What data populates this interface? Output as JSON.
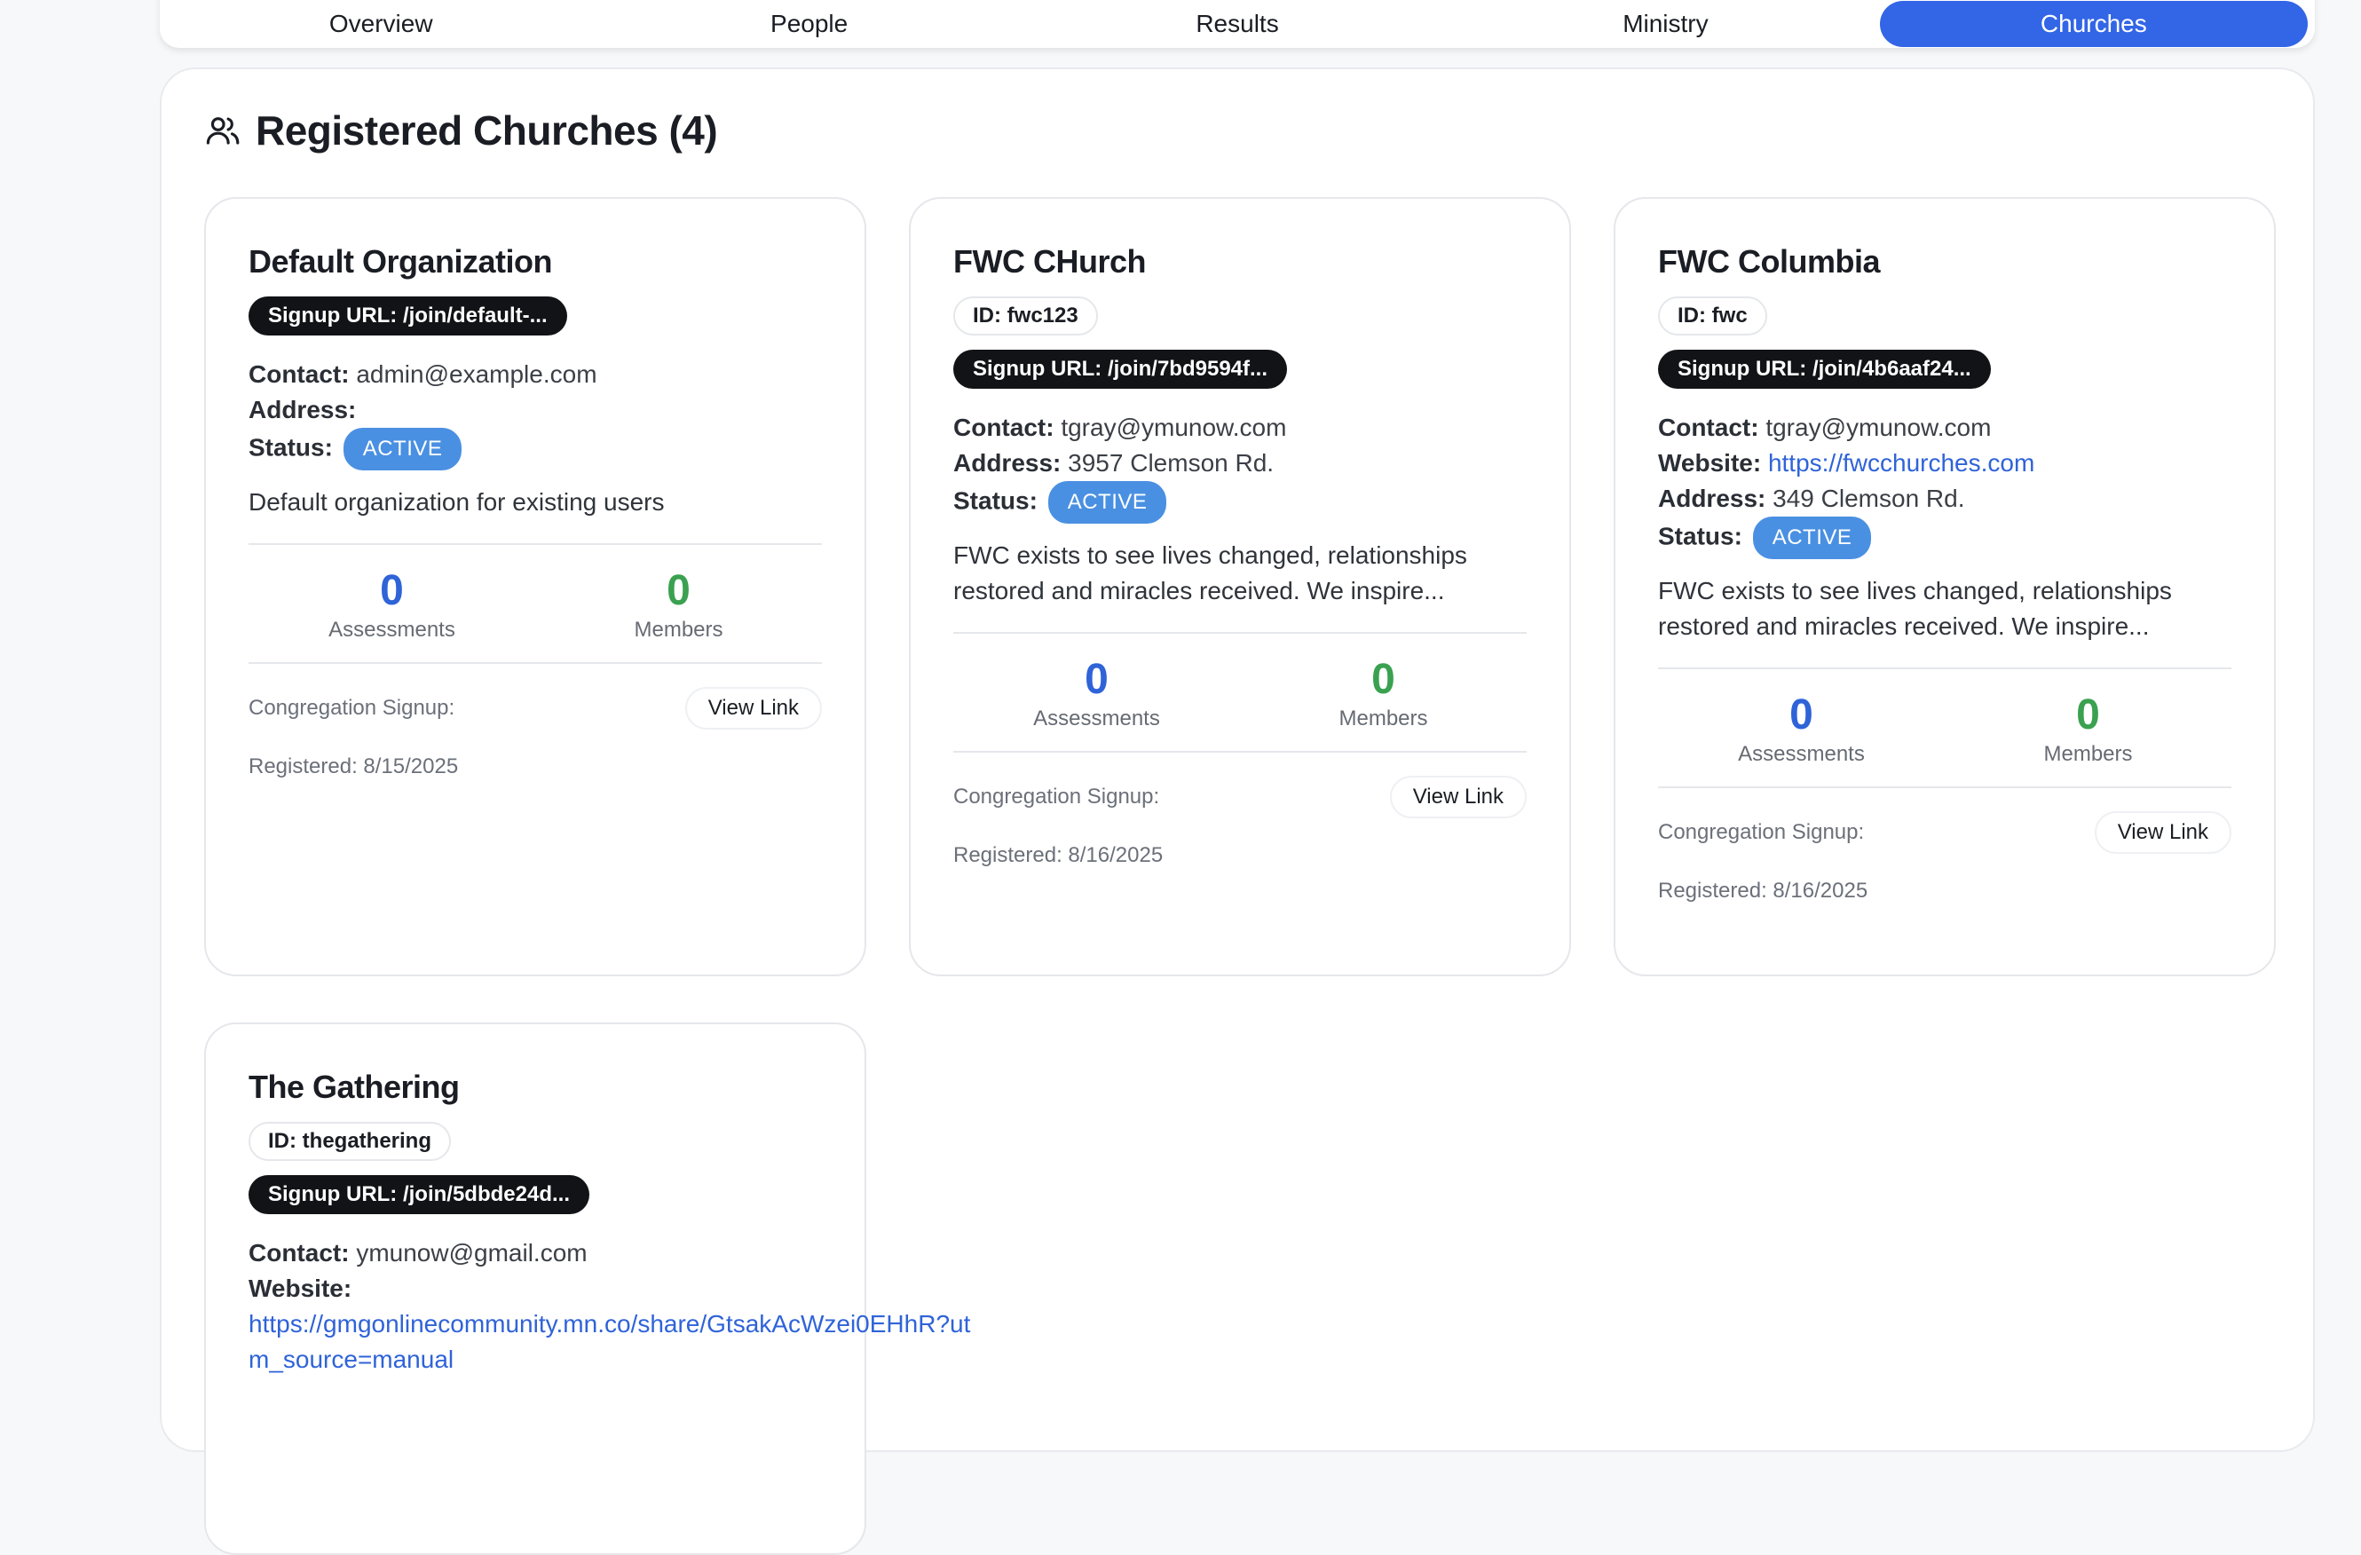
{
  "tabs": [
    "Overview",
    "People",
    "Results",
    "Ministry",
    "Churches"
  ],
  "active_tab": "Churches",
  "panel": {
    "title": "Registered Churches (4)"
  },
  "labels": {
    "contact": "Contact:",
    "address": "Address:",
    "status": "Status:",
    "website": "Website:",
    "assessments": "Assessments",
    "members": "Members",
    "congregation_signup": "Congregation Signup:",
    "view_link": "View Link"
  },
  "churches": [
    {
      "name": "Default Organization",
      "signup_url": "Signup URL: /join/default-...",
      "contact": "admin@example.com",
      "address": "",
      "status": "ACTIVE",
      "description": "Default organization for existing users",
      "assessments": "0",
      "members": "0",
      "registered": "Registered: 8/15/2025"
    },
    {
      "name": "FWC CHurch",
      "id": "ID: fwc123",
      "signup_url": "Signup URL: /join/7bd9594f...",
      "contact": "tgray@ymunow.com",
      "address": "3957 Clemson Rd.",
      "status": "ACTIVE",
      "description": "FWC exists to see lives changed, relationships restored and miracles received. We inspire...",
      "assessments": "0",
      "members": "0",
      "registered": "Registered: 8/16/2025"
    },
    {
      "name": "FWC Columbia",
      "id": "ID: fwc",
      "signup_url": "Signup URL: /join/4b6aaf24...",
      "contact": "tgray@ymunow.com",
      "website": "https://fwcchurches.com",
      "address": "349 Clemson Rd.",
      "status": "ACTIVE",
      "description": "FWC exists to see lives changed, relationships restored and miracles received. We inspire...",
      "assessments": "0",
      "members": "0",
      "registered": "Registered: 8/16/2025"
    },
    {
      "name": "The Gathering",
      "id": "ID: thegathering",
      "signup_url": "Signup URL: /join/5dbde24d...",
      "contact": "ymunow@gmail.com",
      "website": "https://gmgonlinecommunity.mn.co/share/GtsakAcWzei0EHhR?utm_source=manual"
    }
  ],
  "colors": {
    "accent": "#3366e6",
    "status_badge": "#4a90e2",
    "assessments": "#2f63d8",
    "members": "#3aa150"
  }
}
